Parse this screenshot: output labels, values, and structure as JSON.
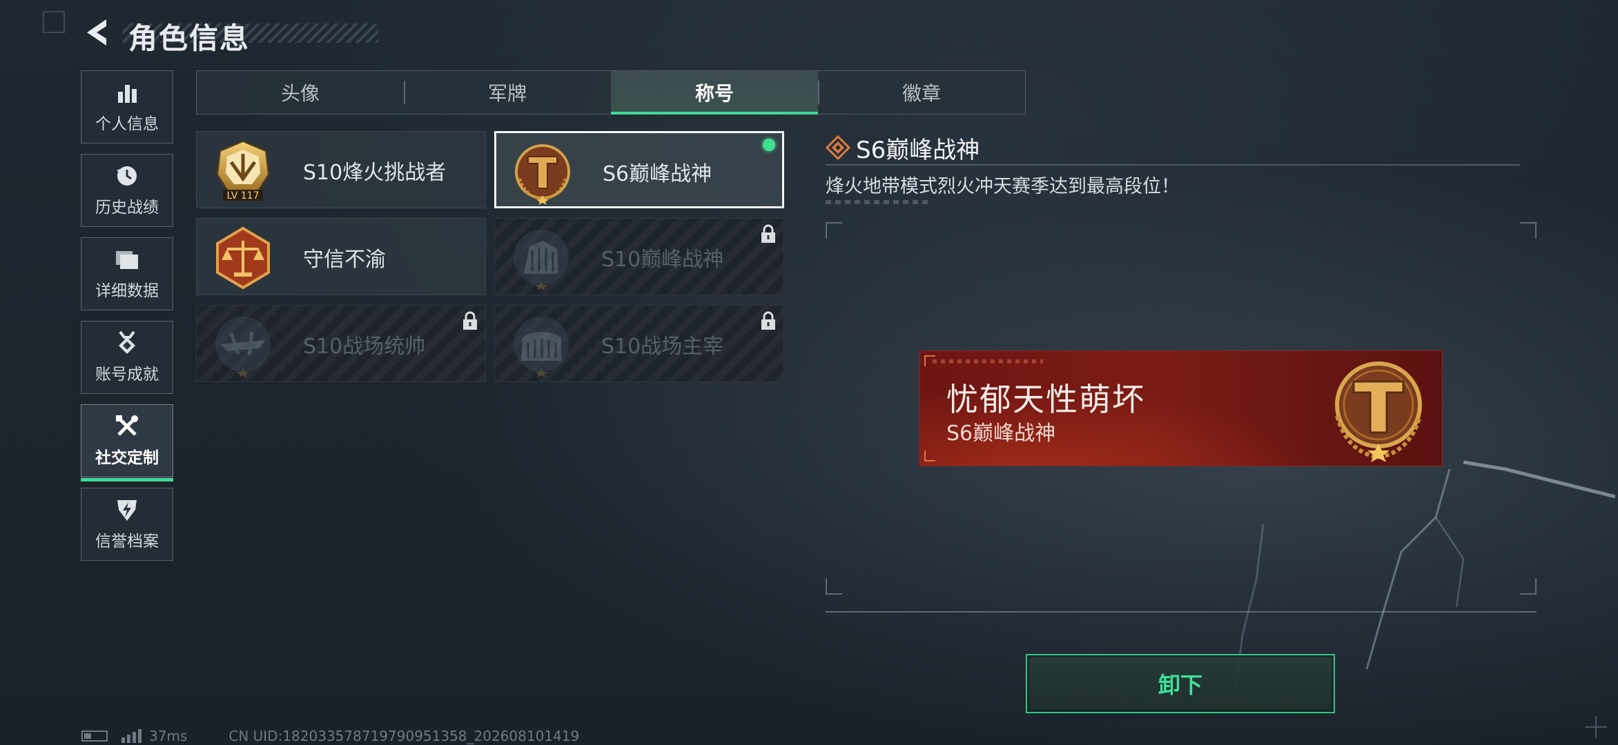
{
  "header": {
    "title": "角色信息"
  },
  "sidebar": {
    "items": [
      {
        "label": "个人信息",
        "icon": "bar-chart-icon",
        "active": false
      },
      {
        "label": "历史战绩",
        "icon": "clock-history-icon",
        "active": false
      },
      {
        "label": "详细数据",
        "icon": "folder-icon",
        "active": false
      },
      {
        "label": "账号成就",
        "icon": "medal-icon",
        "active": false
      },
      {
        "label": "社交定制",
        "icon": "tools-icon",
        "active": true
      },
      {
        "label": "信誉档案",
        "icon": "shield-lightning-icon",
        "active": false
      }
    ]
  },
  "tabs": [
    {
      "label": "头像",
      "active": false
    },
    {
      "label": "军牌",
      "active": false
    },
    {
      "label": "称号",
      "active": true
    },
    {
      "label": "徽章",
      "active": false
    }
  ],
  "titles": [
    {
      "label": "S10烽火挑战者",
      "locked": false,
      "selected": false,
      "equipped": false,
      "emblem": "challenger-lv117-emblem",
      "level_text": "LV 117"
    },
    {
      "label": "S6巅峰战神",
      "locked": false,
      "selected": true,
      "equipped": true,
      "emblem": "peak-war-god-emblem"
    },
    {
      "label": "守信不渝",
      "locked": false,
      "selected": false,
      "equipped": false,
      "emblem": "scales-emblem"
    },
    {
      "label": "S10巅峰战神",
      "locked": true,
      "selected": false,
      "equipped": false,
      "emblem": "arena-emblem"
    },
    {
      "label": "S10战场统帅",
      "locked": true,
      "selected": false,
      "equipped": false,
      "emblem": "aircraft-emblem"
    },
    {
      "label": "S10战场主宰",
      "locked": true,
      "selected": false,
      "equipped": false,
      "emblem": "colosseum-emblem"
    }
  ],
  "detail": {
    "title": "S6巅峰战神",
    "description": "烽火地带模式烈火冲天赛季达到最高段位！"
  },
  "preview": {
    "player_name": "忧郁天性萌坏",
    "title": "S6巅峰战神"
  },
  "actions": {
    "unequip_label": "卸下"
  },
  "status_bar": {
    "ping": "37ms",
    "uid": "CN UID:182033578719790951358_202608101419"
  },
  "colors": {
    "accent": "#3fd89a",
    "plate_red": "#7a1c16",
    "gold": "#c8923a"
  }
}
